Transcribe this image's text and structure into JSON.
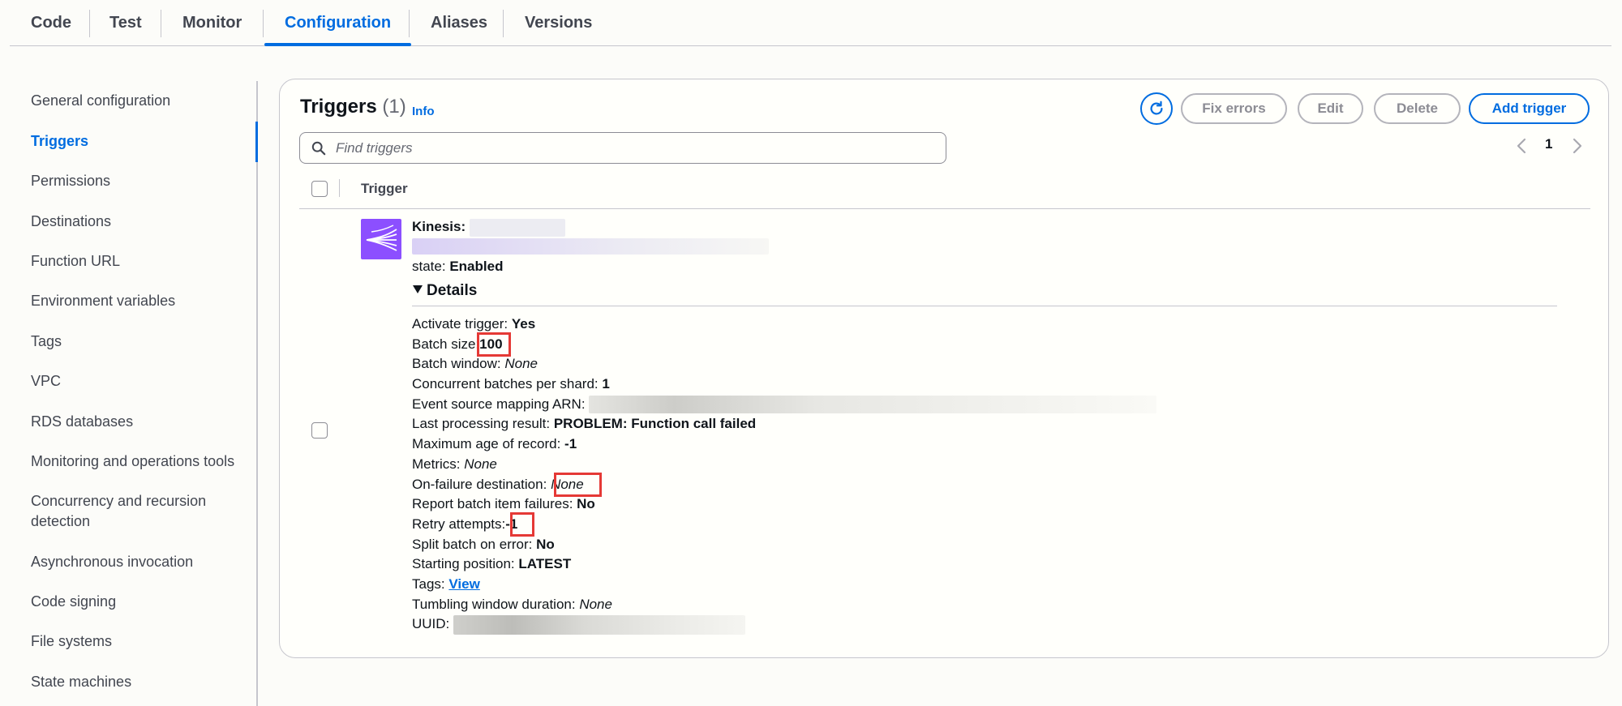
{
  "tabs": [
    {
      "label": "Code",
      "active": false
    },
    {
      "label": "Test",
      "active": false
    },
    {
      "label": "Monitor",
      "active": false
    },
    {
      "label": "Configuration",
      "active": true
    },
    {
      "label": "Aliases",
      "active": false
    },
    {
      "label": "Versions",
      "active": false
    }
  ],
  "sidebar": {
    "active_item": "Triggers",
    "items": [
      "General configuration",
      "Triggers",
      "Permissions",
      "Destinations",
      "Function URL",
      "Environment variables",
      "Tags",
      "VPC",
      "RDS databases",
      "Monitoring and operations tools",
      "Concurrency and recursion detection",
      "Asynchronous invocation",
      "Code signing",
      "File systems",
      "State machines"
    ]
  },
  "panel": {
    "title": "Triggers",
    "count": "(1)",
    "info": "Info",
    "buttons": {
      "refresh_icon": "refresh-icon",
      "fix_errors": "Fix errors",
      "edit": "Edit",
      "delete": "Delete",
      "add_trigger": "Add trigger"
    },
    "search_placeholder": "Find triggers",
    "pagination": {
      "current_page": "1"
    },
    "column_header": "Trigger"
  },
  "trigger": {
    "source_label": "Kinesis:",
    "icon": "kinesis-icon",
    "state_label": "state:",
    "state_value": "Enabled",
    "details_label": "Details",
    "details": {
      "activate_trigger": {
        "label": "Activate trigger:",
        "value": "Yes"
      },
      "batch_size": {
        "label": "Batch size:",
        "value": "100"
      },
      "batch_window": {
        "label": "Batch window:",
        "value": "None"
      },
      "concurrent_batches": {
        "label": "Concurrent batches per shard:",
        "value": "1"
      },
      "esm_arn": {
        "label": "Event source mapping ARN:"
      },
      "last_processing_result": {
        "label": "Last processing result:",
        "value": "PROBLEM: Function call failed"
      },
      "max_age": {
        "label": "Maximum age of record:",
        "value": "-1"
      },
      "metrics": {
        "label": "Metrics:",
        "value": "None"
      },
      "on_failure": {
        "label": "On-failure destination:",
        "value": "None"
      },
      "report_batch_failures": {
        "label": "Report batch item failures:",
        "value": "No"
      },
      "retry_attempts": {
        "label": "Retry attempts:",
        "value": "-1"
      },
      "split_batch": {
        "label": "Split batch on error:",
        "value": "No"
      },
      "starting_position": {
        "label": "Starting position:",
        "value": "LATEST"
      },
      "tags": {
        "label": "Tags:",
        "value": "View"
      },
      "tumbling_window": {
        "label": "Tumbling window duration:",
        "value": "None"
      },
      "uuid": {
        "label": "UUID:"
      }
    }
  },
  "colors": {
    "accent": "#006ce0",
    "highlight_box": "#e53935",
    "kinesis_purple": "#8c4fff"
  }
}
